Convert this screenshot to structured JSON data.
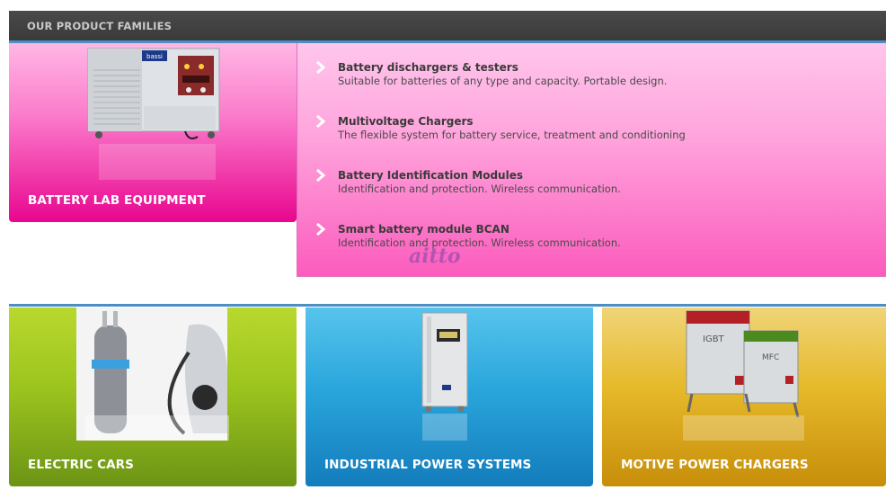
{
  "header": {
    "title": "OUR PRODUCT FAMILIES"
  },
  "battery_lab": {
    "title": "BATTERY LAB EQUIPMENT",
    "image_icon": "battery-tester-machine-image",
    "device_logo": "bassi",
    "items": [
      {
        "title": "Battery dischargers & testers",
        "desc": "Suitable for batteries of any type and capacity. Portable design."
      },
      {
        "title": "Multivoltage Chargers",
        "desc": "The flexible system for battery service, treatment and conditioning"
      },
      {
        "title": "Battery Identification Modules",
        "desc": "Identification and protection. Wireless communication."
      },
      {
        "title": "Smart battery module BCAN",
        "desc": "Identification and protection. Wireless communication."
      }
    ]
  },
  "watermark": "aitto",
  "cards": [
    {
      "title": "ELECTRIC CARS",
      "image_icon": "ev-charging-plug-image"
    },
    {
      "title": "INDUSTRIAL POWER SYSTEMS",
      "image_icon": "industrial-cabinet-image"
    },
    {
      "title": "MOTIVE POWER CHARGERS",
      "image_icon": "motive-chargers-image",
      "labels": [
        "IGBT",
        "MFC"
      ]
    }
  ],
  "colors": {
    "header_bg": "#404040",
    "accent_blue": "#4d8fc5",
    "pink": "#e8068e",
    "green": "#9cc41e",
    "blue": "#2aa6dc",
    "gold": "#e6b92a"
  }
}
